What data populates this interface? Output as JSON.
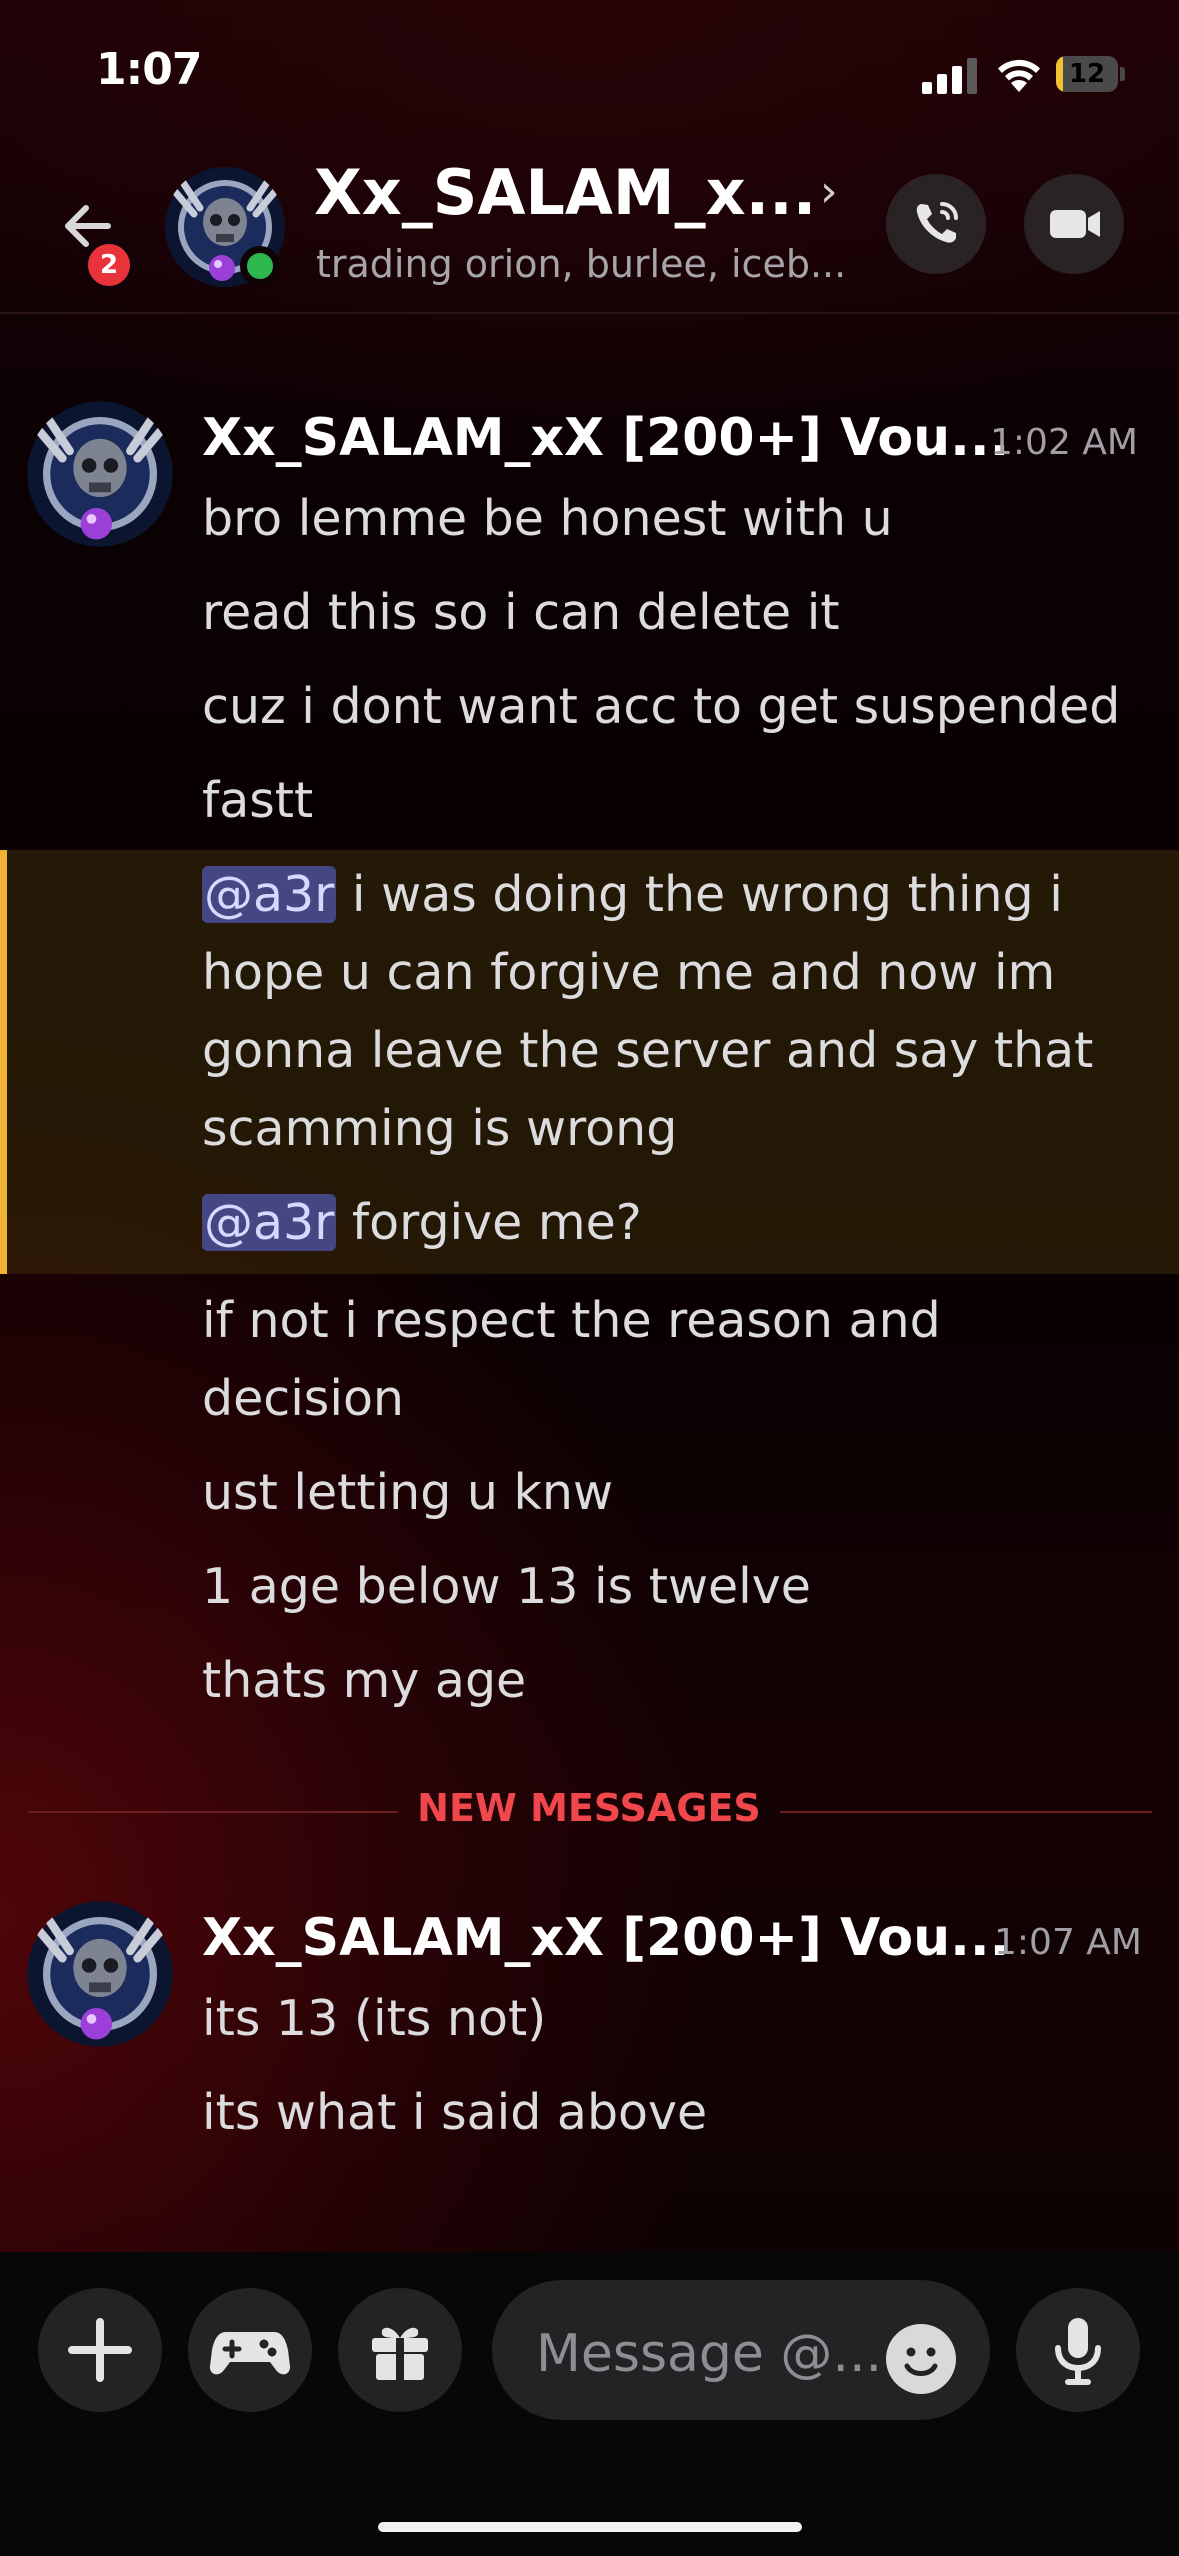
{
  "status_bar": {
    "time": "1:07",
    "battery": "12",
    "battery_level": 0.12
  },
  "header": {
    "unread_count": "2",
    "title": "Xx_SALAM_x...",
    "subtitle": "trading orion, burlee, iceb...",
    "icons": {
      "back": "arrow-left-icon",
      "call": "phone-call-icon",
      "video": "video-camera-icon",
      "chevron": "chevron-right-icon"
    }
  },
  "messages": [
    {
      "author": "Xx_SALAM_xX [200+] Vou...",
      "time": "1:02 AM",
      "lines": [
        {
          "text": "bro lemme be honest with u"
        },
        {
          "text": "read this so i can delete it"
        },
        {
          "text": "cuz i dont want acc to get suspended"
        },
        {
          "text": "fastt"
        },
        {
          "mention": "@a3r",
          "text": " i was doing the wrong thing i"
        },
        {
          "text": "hope u can forgive me and now im"
        },
        {
          "text": "gonna leave the server and say that"
        },
        {
          "text": "scamming is wrong"
        },
        {
          "mention": "@a3r",
          "text": " forgive me?"
        },
        {
          "text": "if not i respect the reason and"
        },
        {
          "text": "decision"
        },
        {
          "text": "ust letting u knw"
        },
        {
          "text": "1 age below 13   is twelve"
        },
        {
          "text": "thats my age"
        }
      ]
    },
    {
      "author": "Xx_SALAM_xX [200+] Vou...",
      "time": "1:07 AM",
      "lines": [
        {
          "text": "its 13 (its not)"
        },
        {
          "text": "its what i said above"
        }
      ]
    }
  ],
  "divider": {
    "label": "NEW MESSAGES"
  },
  "composer": {
    "placeholder": "Message @...",
    "icons": {
      "plus": "plus-icon",
      "games": "gamepad-icon",
      "gift": "gift-icon",
      "emoji": "emoji-face-icon",
      "mic": "microphone-icon"
    }
  },
  "colors": {
    "mention_bg": "#454783",
    "highlight_bar": "#f0b232",
    "new_messages": "#f0474d",
    "online": "#2db84f",
    "badge": "#e8333a"
  }
}
